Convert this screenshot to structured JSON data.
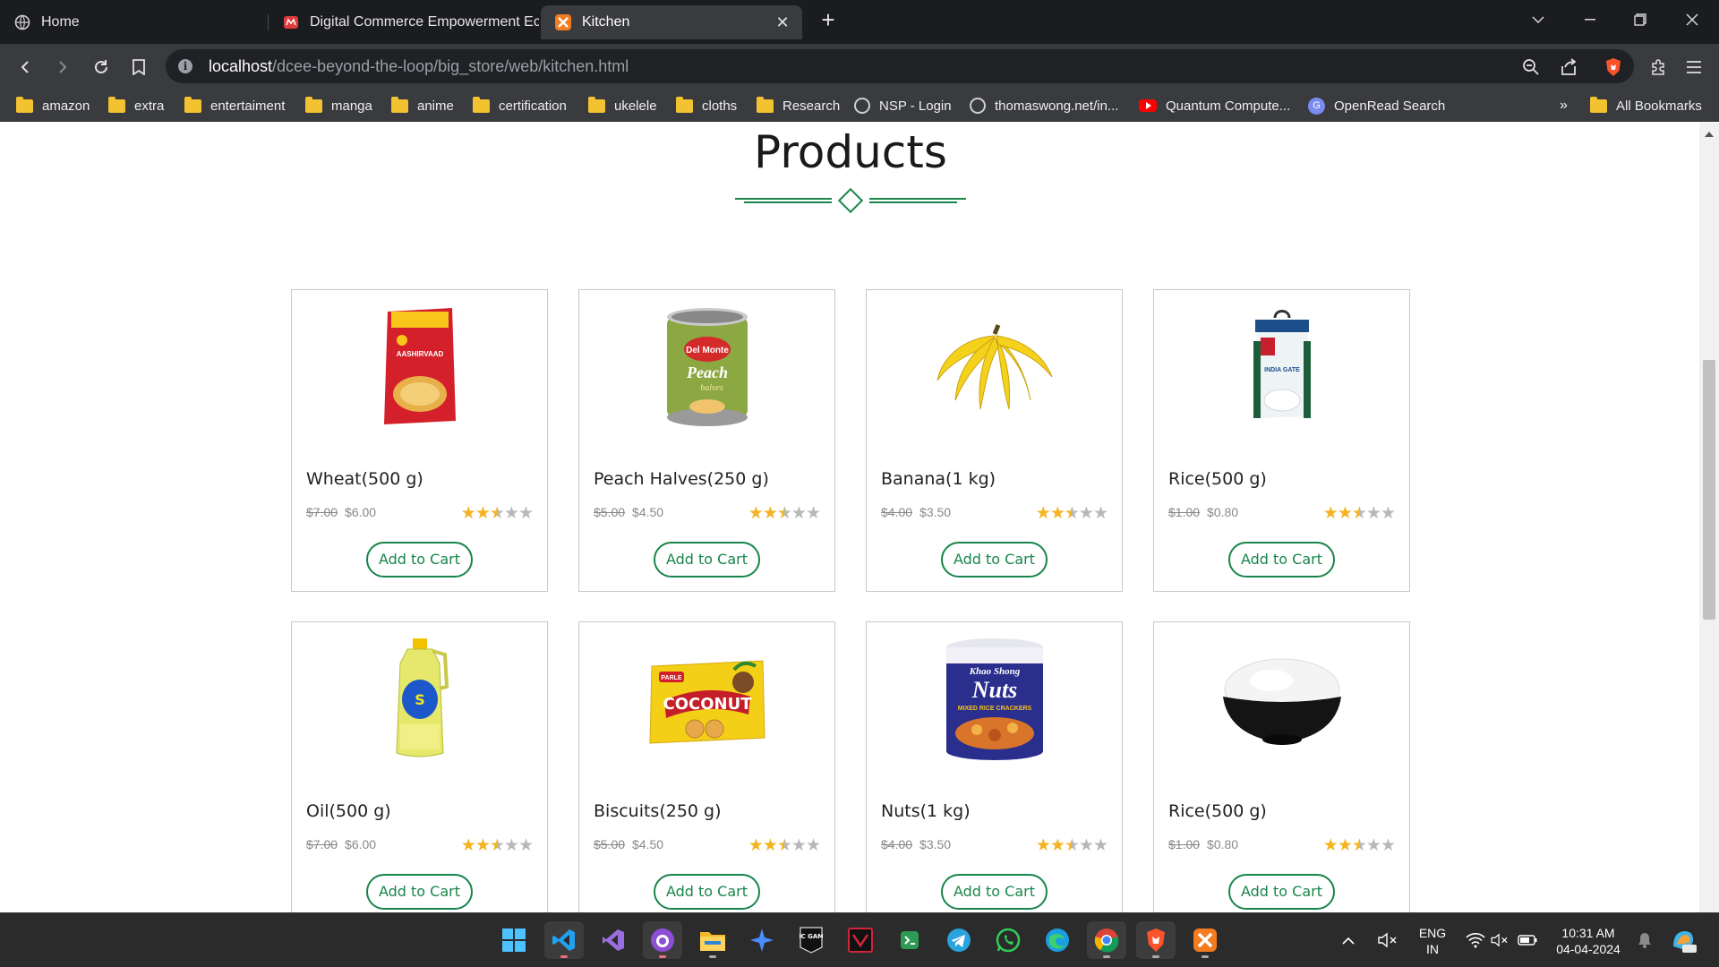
{
  "browser": {
    "tabs": [
      {
        "label": "Home",
        "icon": "globe-icon"
      },
      {
        "label": "Digital Commerce Empowerment Ec",
        "icon": "store-icon"
      },
      {
        "label": "Kitchen",
        "icon": "xampp-icon"
      }
    ],
    "active_tab": "Kitchen",
    "url": {
      "host": "localhost",
      "path": "/dcee-beyond-the-loop/big_store/web/kitchen.html"
    },
    "bookmarks": [
      {
        "label": "amazon",
        "icon": "folder-icon"
      },
      {
        "label": "extra",
        "icon": "folder-icon"
      },
      {
        "label": "entertaiment",
        "icon": "folder-icon"
      },
      {
        "label": "manga",
        "icon": "folder-icon"
      },
      {
        "label": "anime",
        "icon": "folder-icon"
      },
      {
        "label": "certification",
        "icon": "folder-icon"
      },
      {
        "label": "ukelele",
        "icon": "folder-icon"
      },
      {
        "label": "cloths",
        "icon": "folder-icon"
      },
      {
        "label": "Research",
        "icon": "folder-icon"
      },
      {
        "label": "NSP - Login",
        "icon": "globe-icon"
      },
      {
        "label": "thomaswong.net/in...",
        "icon": "globe-icon"
      },
      {
        "label": "Quantum Compute...",
        "icon": "youtube-icon"
      },
      {
        "label": "OpenRead Search",
        "icon": "openread-icon"
      }
    ],
    "bookmarks_overflow": "»",
    "all_bookmarks": "All Bookmarks"
  },
  "page": {
    "title": "Products",
    "products": [
      {
        "name": "Wheat(500 g)",
        "old_price": "$7.00",
        "price": "$6.00",
        "rating": 2.5,
        "button": "Add to Cart",
        "image": "wheat-flour-pack"
      },
      {
        "name": "Peach Halves(250 g)",
        "old_price": "$5.00",
        "price": "$4.50",
        "rating": 2.5,
        "button": "Add to Cart",
        "image": "peach-can"
      },
      {
        "name": "Banana(1 kg)",
        "old_price": "$4.00",
        "price": "$3.50",
        "rating": 2.5,
        "button": "Add to Cart",
        "image": "banana-bunch"
      },
      {
        "name": "Rice(500 g)",
        "old_price": "$1.00",
        "price": "$0.80",
        "rating": 2.5,
        "button": "Add to Cart",
        "image": "rice-bag"
      },
      {
        "name": "Oil(500 g)",
        "old_price": "$7.00",
        "price": "$6.00",
        "rating": 2.5,
        "button": "Add to Cart",
        "image": "oil-bottle"
      },
      {
        "name": "Biscuits(250 g)",
        "old_price": "$5.00",
        "price": "$4.50",
        "rating": 2.5,
        "button": "Add to Cart",
        "image": "biscuit-pack"
      },
      {
        "name": "Nuts(1 kg)",
        "old_price": "$4.00",
        "price": "$3.50",
        "rating": 2.5,
        "button": "Add to Cart",
        "image": "nuts-tin"
      },
      {
        "name": "Rice(500 g)",
        "old_price": "$1.00",
        "price": "$0.80",
        "rating": 2.5,
        "button": "Add to Cart",
        "image": "rice-bowl"
      }
    ],
    "image_text": {
      "wheat": "AASHIRVAAD",
      "peach_brand": "Del Monte",
      "peach_label": "Peach",
      "peach_sub": "halves",
      "rice_bag": "INDIA GATE",
      "biscuit_brand": "PARLE",
      "biscuit_label": "COCONUT",
      "nuts_brand": "Khao Shong",
      "nuts_label": "Nuts",
      "nuts_sub": "MIXED RICE CRACKERS"
    }
  },
  "taskbar": {
    "apps": [
      "windows-start-icon",
      "vscode-icon",
      "visual-studio-icon",
      "github-desktop-icon",
      "file-explorer-icon",
      "copilot-icon",
      "epic-games-icon",
      "vivaldi-icon",
      "android-studio-icon",
      "telegram-icon",
      "whatsapp-icon",
      "edge-icon",
      "chrome-icon",
      "brave-icon",
      "xampp-icon"
    ],
    "epic_label": "EPIC GAMES",
    "language": {
      "line1": "ENG",
      "line2": "IN"
    },
    "clock": {
      "time": "10:31 AM",
      "date": "04-04-2024"
    }
  },
  "colors": {
    "accent_green": "#18854a",
    "star": "#f4b322",
    "chrome_dark": "#1b1c1f",
    "chrome_mid": "#3a3b3f"
  }
}
